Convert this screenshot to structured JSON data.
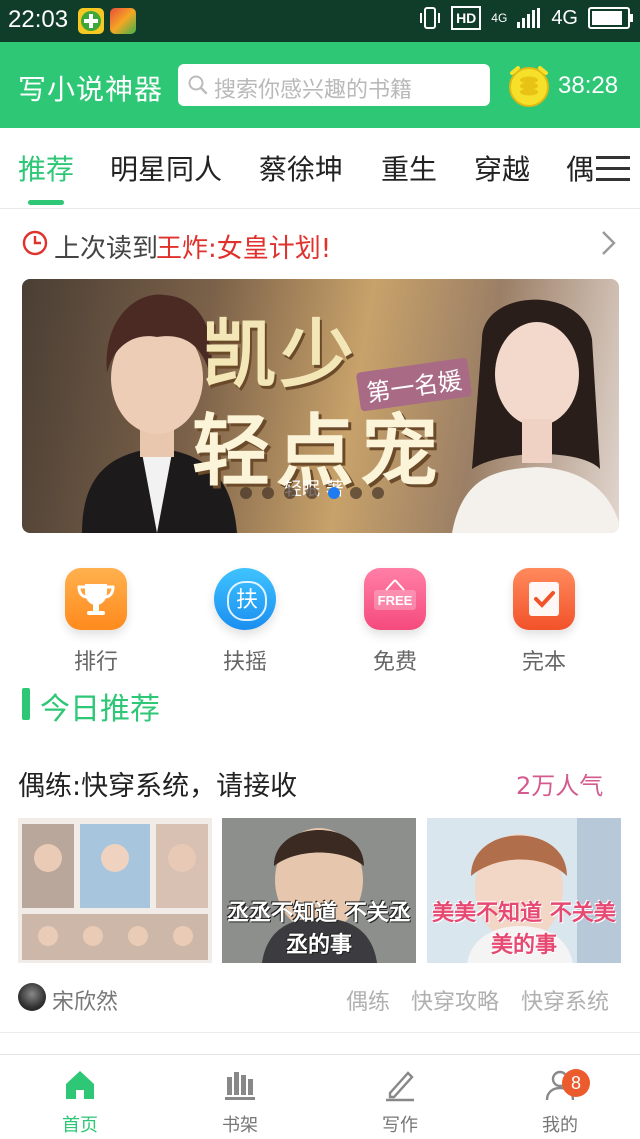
{
  "status_bar": {
    "time": "22:03",
    "hd": "HD",
    "network_small": "4G",
    "network": "4G"
  },
  "header": {
    "title": "写小说神器",
    "search_placeholder": "搜索你感兴趣的书籍",
    "timer": "38:28"
  },
  "tabs": [
    {
      "label": "推荐",
      "active": true
    },
    {
      "label": "明星同人"
    },
    {
      "label": "蔡徐坤"
    },
    {
      "label": "重生"
    },
    {
      "label": "穿越"
    },
    {
      "label": "偶"
    }
  ],
  "last_read": {
    "label": "上次读到",
    "book": "王炸:女皇计划!"
  },
  "banner": {
    "title_line1": "凯少",
    "subtitle": "第一名媛",
    "title_line2": "轻点宠",
    "author": "轻眠 著",
    "active_slide": 5,
    "slide_count": 7
  },
  "quick_links": [
    {
      "label": "排行",
      "icon": "trophy-icon"
    },
    {
      "label": "扶摇",
      "icon": "fuyao-icon",
      "glyph": "扶"
    },
    {
      "label": "免费",
      "icon": "free-sign-icon",
      "glyph": "FREE"
    },
    {
      "label": "完本",
      "icon": "check-book-icon"
    }
  ],
  "section": {
    "title": "今日推荐"
  },
  "book": {
    "title": "偶练:快穿系统，请接收",
    "popularity": "2万人气",
    "thumb_captions": [
      "",
      "丞丞不知道 不关丞丞的事",
      "美美不知道 不关美美的事"
    ],
    "author": "宋欣然",
    "tags": [
      "偶练",
      "快穿攻略",
      "快穿系统"
    ]
  },
  "bottom_nav": [
    {
      "label": "首页",
      "icon": "home-icon",
      "active": true
    },
    {
      "label": "书架",
      "icon": "bookshelf-icon"
    },
    {
      "label": "写作",
      "icon": "pen-icon"
    },
    {
      "label": "我的",
      "icon": "profile-icon",
      "badge": "8"
    }
  ],
  "colors": {
    "brand": "#2ec776",
    "status_bar": "#0f3d2a",
    "last_read_book": "#e0322d",
    "popularity": "#d45b8e",
    "badge": "#ec5b2d"
  }
}
